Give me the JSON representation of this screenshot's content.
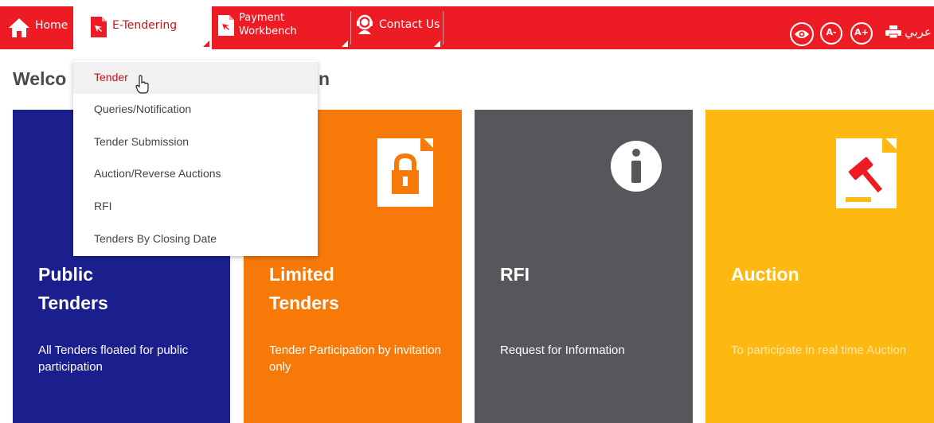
{
  "nav": {
    "home": "Home",
    "etendering": "E-Tendering",
    "payment_line1": "Payment",
    "payment_line2": "Workbench",
    "contact": "Contact Us",
    "language": "عربي",
    "font_decrease": "A-",
    "font_increase": "A+"
  },
  "welcome": {
    "visible_start": "Welco",
    "visible_end": "n"
  },
  "dropdown": {
    "items": [
      {
        "label": "Tender"
      },
      {
        "label": "Queries/Notification"
      },
      {
        "label": "Tender Submission"
      },
      {
        "label": "Auction/Reverse Auctions"
      },
      {
        "label": "RFI"
      },
      {
        "label": "Tenders By Closing Date"
      }
    ],
    "active_index": 0
  },
  "tiles": [
    {
      "title_line1": "Public",
      "title_line2": "Tenders",
      "desc": "All Tenders floated for public participation",
      "color": "#1b1f8e"
    },
    {
      "title_line1": "Limited",
      "title_line2": "Tenders",
      "desc": "Tender Participation by invitation only",
      "color": "#f77a08",
      "icon": "lock-document-icon"
    },
    {
      "title_line1": "RFI",
      "title_line2": "",
      "desc": "Request for Information",
      "color": "#56575b",
      "icon": "info-icon"
    },
    {
      "title_line1": "Auction",
      "title_line2": "",
      "desc": "To participate in real time Auction",
      "color": "#fdb912",
      "icon": "gavel-document-icon"
    }
  ],
  "colors": {
    "brand_red": "#ed1c24",
    "active_red": "#c3141c",
    "text_gray": "#4a4a4a"
  }
}
